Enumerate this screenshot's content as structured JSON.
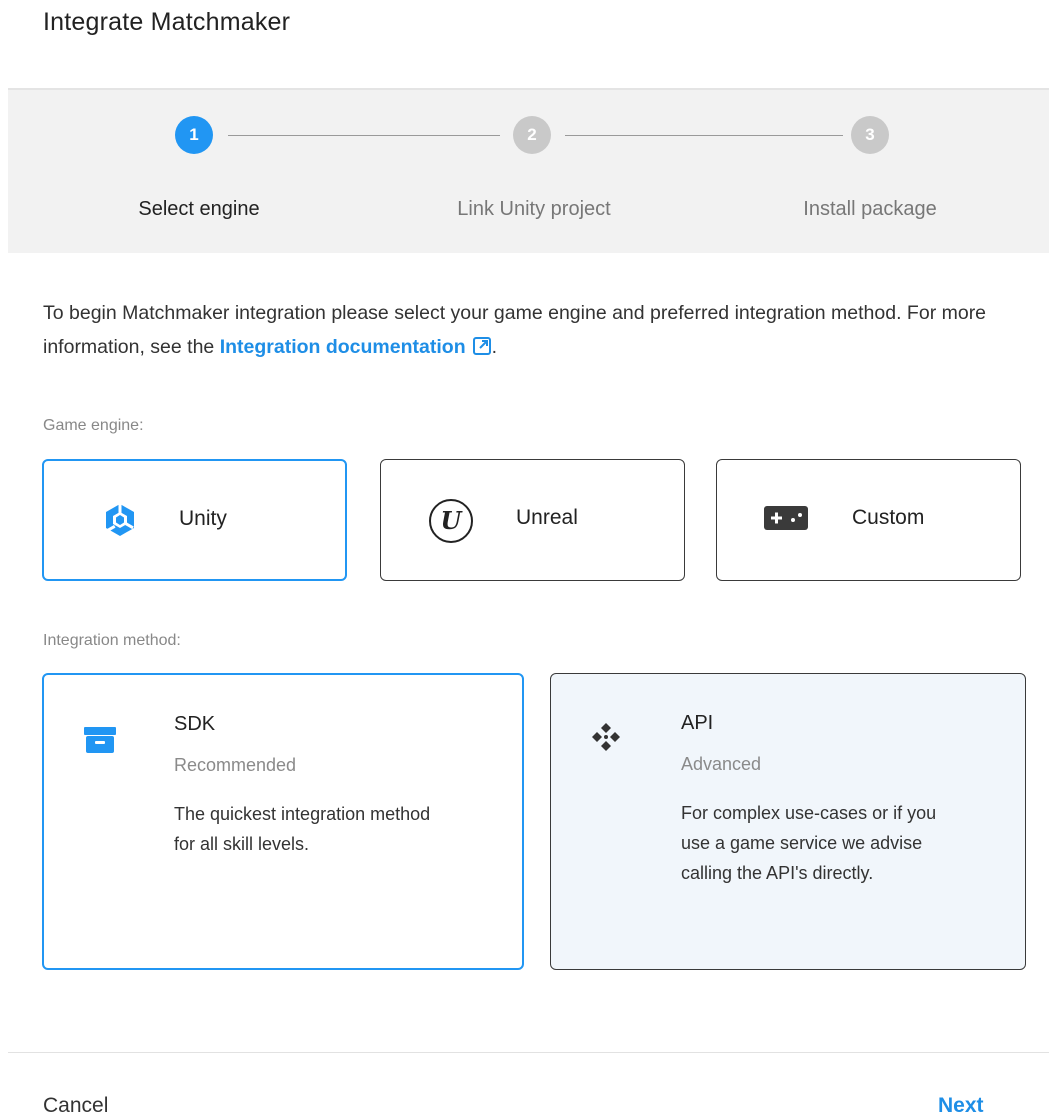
{
  "dialog": {
    "title": "Integrate Matchmaker"
  },
  "stepper": {
    "steps": [
      {
        "number": "1",
        "label": "Select engine",
        "state": "active"
      },
      {
        "number": "2",
        "label": "Link Unity project",
        "state": "inactive"
      },
      {
        "number": "3",
        "label": "Install package",
        "state": "inactive"
      }
    ]
  },
  "intro": {
    "text_before": "To begin Matchmaker integration please select your game engine and preferred integration method. For more information, see the ",
    "link_text": "Integration documentation",
    "text_after": "."
  },
  "engine": {
    "label": "Game engine:",
    "options": [
      {
        "label": "Unity",
        "icon": "unity-logo-icon",
        "selected": true
      },
      {
        "label": "Unreal",
        "icon": "unreal-logo-icon",
        "selected": false
      },
      {
        "label": "Custom",
        "icon": "gamepad-icon",
        "selected": false
      }
    ]
  },
  "method": {
    "label": "Integration method:",
    "options": [
      {
        "title": "SDK",
        "subtitle": "Recommended",
        "description": "The quickest integration method for all skill levels.",
        "icon": "package-box-icon",
        "selected": true
      },
      {
        "title": "API",
        "subtitle": "Advanced",
        "description": "For complex use-cases or if you use a game service we advise calling the API's directly.",
        "icon": "api-diamond-icon",
        "selected": false
      }
    ]
  },
  "footer": {
    "cancel_label": "Cancel",
    "next_label": "Next"
  },
  "colors": {
    "accent": "#2196f3",
    "link": "#1e8ee6",
    "stepper_bg": "#f2f2f2",
    "api_card_bg": "#f1f6fb"
  }
}
